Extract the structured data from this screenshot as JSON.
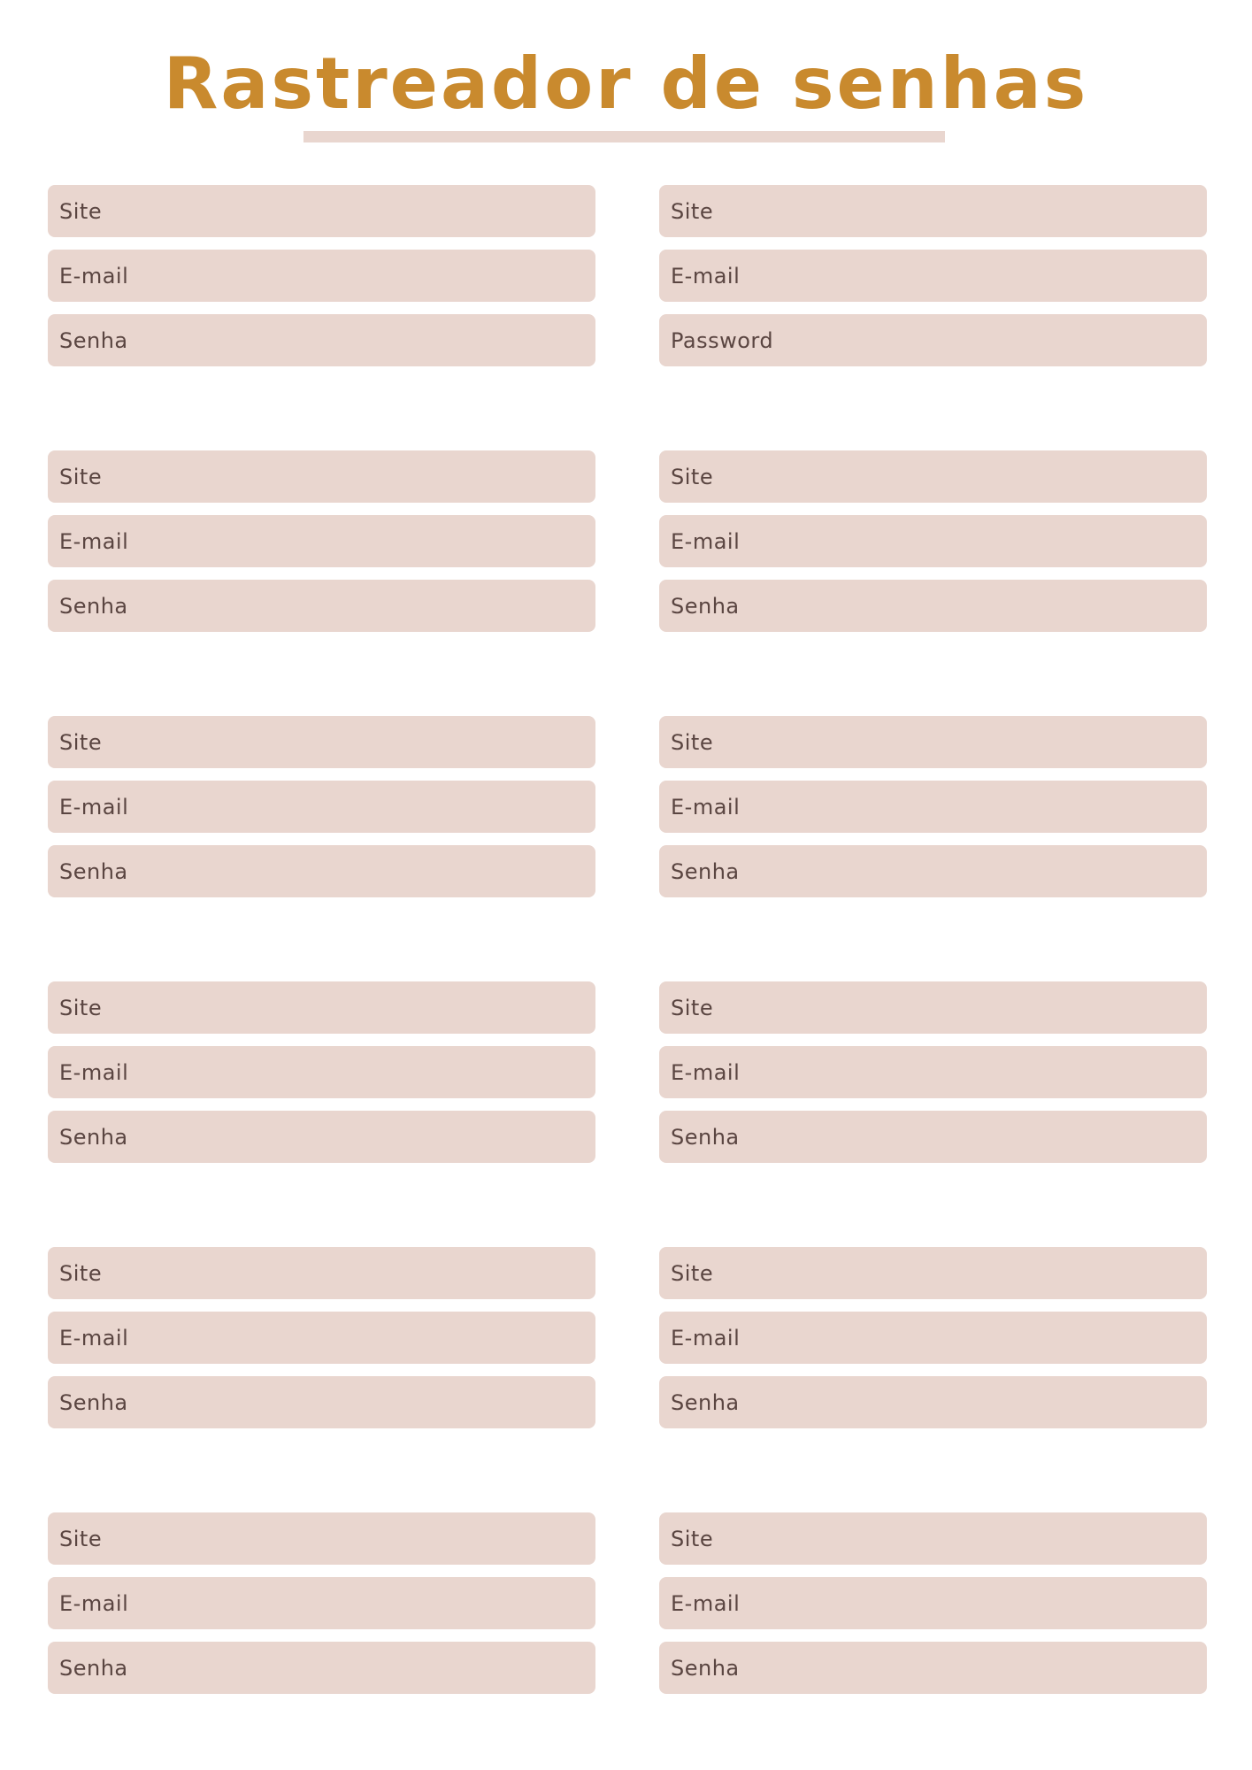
{
  "title": "Rastreador de senhas",
  "colors": {
    "title": "#c98a2e",
    "field_bg": "#e9d6cf",
    "label": "#5a4541",
    "background": "#ffffff"
  },
  "entries": [
    {
      "site": "Site",
      "email": "E-mail",
      "password": "Senha"
    },
    {
      "site": "Site",
      "email": "E-mail",
      "password": "Password"
    },
    {
      "site": "Site",
      "email": "E-mail",
      "password": "Senha"
    },
    {
      "site": "Site",
      "email": "E-mail",
      "password": "Senha"
    },
    {
      "site": "Site",
      "email": "E-mail",
      "password": "Senha"
    },
    {
      "site": "Site",
      "email": "E-mail",
      "password": "Senha"
    },
    {
      "site": "Site",
      "email": "E-mail",
      "password": "Senha"
    },
    {
      "site": "Site",
      "email": "E-mail",
      "password": "Senha"
    },
    {
      "site": "Site",
      "email": "E-mail",
      "password": "Senha"
    },
    {
      "site": "Site",
      "email": "E-mail",
      "password": "Senha"
    },
    {
      "site": "Site",
      "email": "E-mail",
      "password": "Senha"
    },
    {
      "site": "Site",
      "email": "E-mail",
      "password": "Senha"
    }
  ]
}
